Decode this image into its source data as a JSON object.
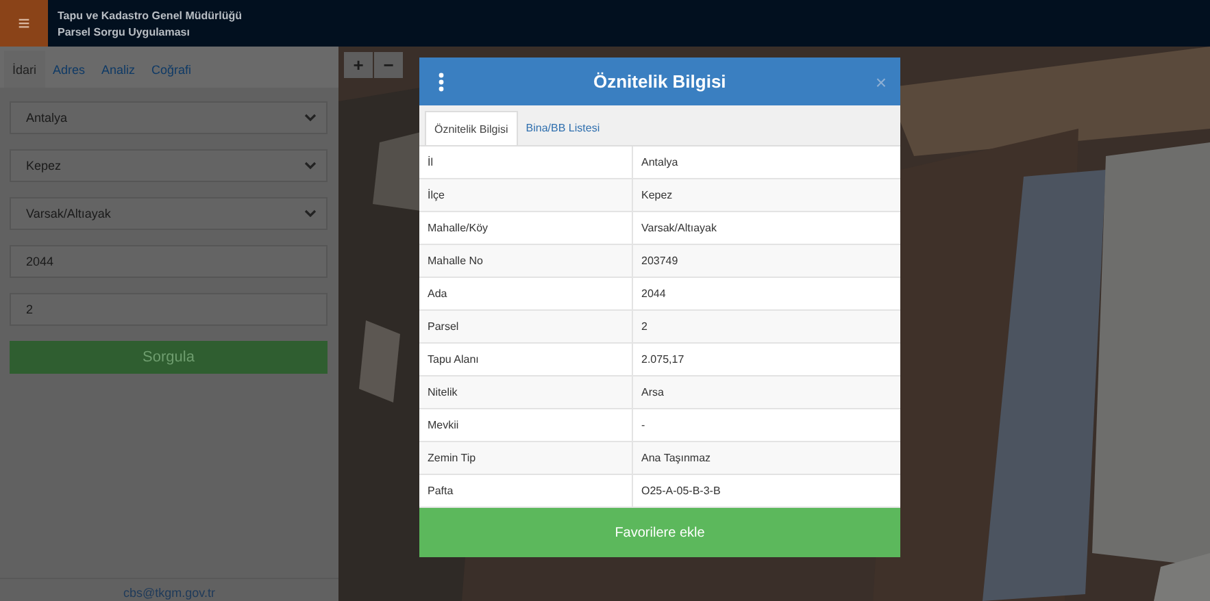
{
  "header": {
    "menu_icon": "≡",
    "title": "Tapu ve Kadastro Genel Müdürlüğü",
    "subtitle": "Parsel Sorgu Uygulaması"
  },
  "sidebar": {
    "tabs": [
      {
        "label": "İdari",
        "selected": true
      },
      {
        "label": "Adres",
        "selected": false
      },
      {
        "label": "Analiz",
        "selected": false
      },
      {
        "label": "Coğrafi",
        "selected": false
      }
    ],
    "fields": [
      {
        "kind": "select",
        "value": "Antalya"
      },
      {
        "kind": "select",
        "value": "Kepez"
      },
      {
        "kind": "select",
        "value": "Varsak/Altıayak"
      },
      {
        "kind": "input",
        "value": "2044"
      },
      {
        "kind": "input",
        "value": "2"
      }
    ],
    "button": "Sorgula",
    "footer": "cbs@tkgm.gov.tr"
  },
  "map": {
    "kind": "picture",
    "controls": [
      "+",
      "−"
    ]
  },
  "modal": {
    "title": "Öznitelik Bilgisi",
    "close": "×",
    "tabs": [
      {
        "label": "Öznitelik Bilgisi",
        "selected": true
      },
      {
        "label": "Bina/BB Listesi",
        "selected": false
      }
    ],
    "rows": [
      {
        "label": "İl",
        "value": "Antalya"
      },
      {
        "label": "İlçe",
        "value": "Kepez"
      },
      {
        "label": "Mahalle/Köy",
        "value": "Varsak/Altıayak"
      },
      {
        "label": "Mahalle No",
        "value": "203749"
      },
      {
        "label": "Ada",
        "value": "2044"
      },
      {
        "label": "Parsel",
        "value": "2"
      },
      {
        "label": "Tapu Alanı",
        "value": "2.075,17"
      },
      {
        "label": "Nitelik",
        "value": "Arsa"
      },
      {
        "label": "Mevkii",
        "value": "-"
      },
      {
        "label": "Zemin Tip",
        "value": "Ana Taşınmaz"
      },
      {
        "label": "Pafta",
        "value": "O25-A-05-B-3-B"
      }
    ],
    "button": "Favorilere ekle"
  }
}
